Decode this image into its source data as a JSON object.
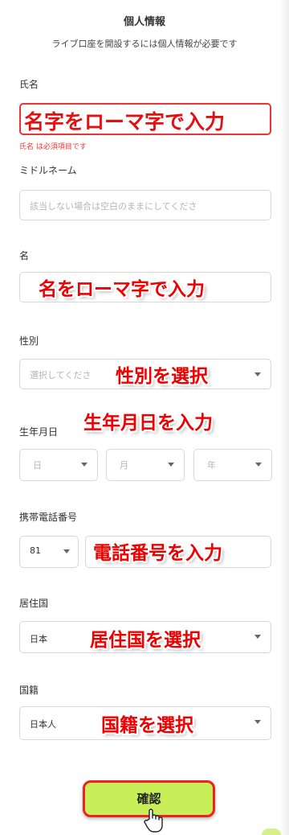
{
  "header": {
    "title": "個人情報",
    "subtitle": "ライブ口座を開設するには個人情報が必要です"
  },
  "last_name": {
    "label": "氏名",
    "overlay": "名字をローマ字で入力",
    "error": "氏名 は必須項目です"
  },
  "middle_name": {
    "label": "ミドルネーム",
    "placeholder": "該当しない場合は空白のままにしてくださ"
  },
  "first_name": {
    "label": "名",
    "overlay": "名をローマ字で入力"
  },
  "gender": {
    "label": "性別",
    "placeholder": "選択してくださ",
    "overlay": "性別を選択"
  },
  "birthdate": {
    "label": "生年月日",
    "overlay": "生年月日を入力",
    "day_placeholder": "日",
    "month_placeholder": "月",
    "year_placeholder": "年"
  },
  "phone": {
    "label": "携帯電話番号",
    "country_code": "81",
    "overlay": "電話番号を入力"
  },
  "residence": {
    "label": "居住国",
    "value": "日本",
    "overlay": "居住国を選択"
  },
  "nationality": {
    "label": "国籍",
    "value": "日本人",
    "overlay": "国籍を選択"
  },
  "confirm": {
    "label": "確認"
  },
  "colors": {
    "error_red": "#ee3333",
    "annotation_red": "#ee0000",
    "button_green": "#c8ee58"
  },
  "icons": [
    "chevron-down-icon",
    "pointer-hand-icon"
  ]
}
